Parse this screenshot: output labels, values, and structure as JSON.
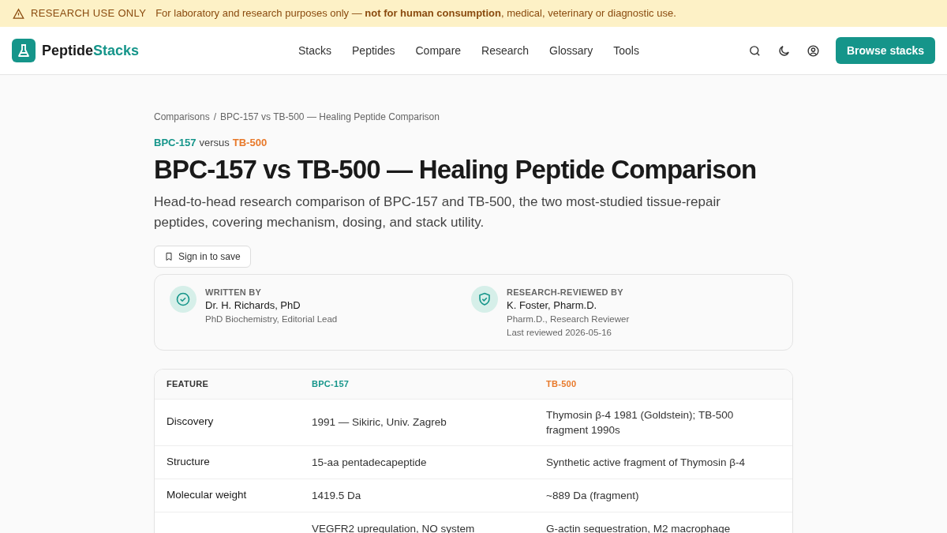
{
  "banner": {
    "label": "RESEARCH USE ONLY",
    "text": "For laboratory and research purposes only — **not for human consumption**, medical, veterinary or diagnostic use."
  },
  "header": {
    "logo_main": "Peptide",
    "logo_accent": "Stacks",
    "nav": [
      "Stacks",
      "Peptides",
      "Compare",
      "Research",
      "Glossary",
      "Tools"
    ],
    "cta": "Browse stacks"
  },
  "breadcrumb": [
    "Comparisons",
    "/",
    "BPC-157 vs TB-500 — Healing Peptide Comparison"
  ],
  "eyebrow": {
    "left": "BPC-157",
    "middle": "versus",
    "right": "TB-500"
  },
  "title": "BPC-157 vs TB-500 — Healing Peptide Comparison",
  "subtitle": "Head-to-head research comparison of BPC-157 and TB-500, the two most-studied tissue-repair peptides, covering mechanism, dosing, and stack utility.",
  "save_button": "Sign in to save",
  "authors": [
    {
      "kind": "writer",
      "role": "WRITTEN BY",
      "name": "Dr. H. Richards, PhD",
      "lines": [
        "PhD Biochemistry, Editorial Lead"
      ]
    },
    {
      "kind": "reviewer",
      "role": "RESEARCH-REVIEWED BY",
      "name": "K. Foster, Pharm.D.",
      "lines": [
        "Pharm.D., Research Reviewer",
        "Last reviewed 2026-05-16"
      ]
    }
  ],
  "table": {
    "columns": [
      "FEATURE",
      "BPC-157",
      "TB-500"
    ],
    "rows": [
      {
        "feature": "Discovery",
        "a": "1991 — Sikiric, Univ. Zagreb",
        "b": "Thymosin β-4 1981 (Goldstein); TB-500 fragment 1990s"
      },
      {
        "feature": "Structure",
        "a": "15-aa pentadecapeptide",
        "b": "Synthetic active fragment of Thymosin β-4"
      },
      {
        "feature": "Molecular weight",
        "a": "1419.5 Da",
        "b": "~889 Da (fragment)"
      },
      {
        "a": "VEGFR2 upregulation, NO system",
        "b": "G-actin sequestration, M2 macrophage"
      }
    ]
  }
}
